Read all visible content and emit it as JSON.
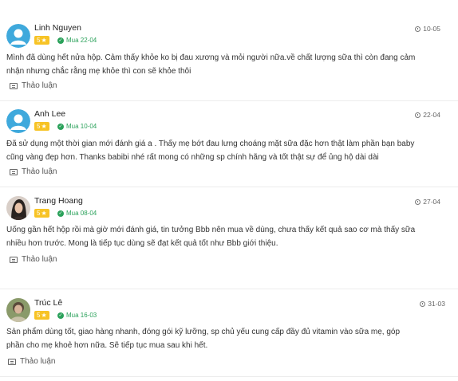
{
  "reviews": [
    {
      "name": "Linh Nguyen",
      "rating": "5",
      "star": "★",
      "bought": "Mua 22-04",
      "date": "10-05",
      "avatar_type": "default-user-icon",
      "line1": "Mình đã dùng hết nửa hộp. Cảm thấy khỏe ko bị đau xương và mỏi người nữa.về chất lượng sữa thì còn đang cảm",
      "line2": "nhận nhưng chắc rằng mẹ khỏe thì con sẽ khỏe thôi",
      "discuss": "Thảo luận"
    },
    {
      "name": "Anh Lee",
      "rating": "5",
      "star": "★",
      "bought": "Mua 10-04",
      "date": "22-04",
      "avatar_type": "default-user-icon",
      "line1": "Đã sử dụng một thời gian mới đánh giá a . Thấy mẹ bớt đau lưng choáng mặt sữa đặc hơn thật làm phần bạn baby",
      "line2": "cũng vàng đẹp hơn. Thanks babibi nhé rất mong có những sp chính hãng và tốt thật sự để ủng hộ dài dài",
      "discuss": "Thảo luận"
    },
    {
      "name": "Trang Hoang",
      "rating": "5",
      "star": "★",
      "bought": "Mua 08-04",
      "date": "27-04",
      "avatar_type": "photo",
      "line1": "Uống gần hết hộp rồi mà giờ mới đánh giá, tin tưởng Bbb nên mua về dùng, chưa thấy kết quả sao cơ mà thấy sữa",
      "line2": "nhiều hơn trước. Mong là tiếp tục dùng sẽ đạt kết quả tốt như Bbb giới thiệu.",
      "discuss": "Thảo luận"
    },
    {
      "name": "Trúc Lê",
      "rating": "5",
      "star": "★",
      "bought": "Mua 16-03",
      "date": "31-03",
      "avatar_type": "photo",
      "line1": "Sản phẩm dùng tốt, giao hàng nhanh, đóng gói kỹ lưỡng, sp chủ yếu cung cấp đầy đủ vitamin vào sữa mẹ, góp",
      "line2": "phần cho mẹ khoẻ hơn nữa. Sẽ tiếp tục mua sau khi hết.",
      "discuss": "Thảo luận"
    }
  ],
  "colors": {
    "star_badge": "#f7c325",
    "bought_green": "#2aa15a",
    "default_avatar": "#3fa9dc"
  }
}
